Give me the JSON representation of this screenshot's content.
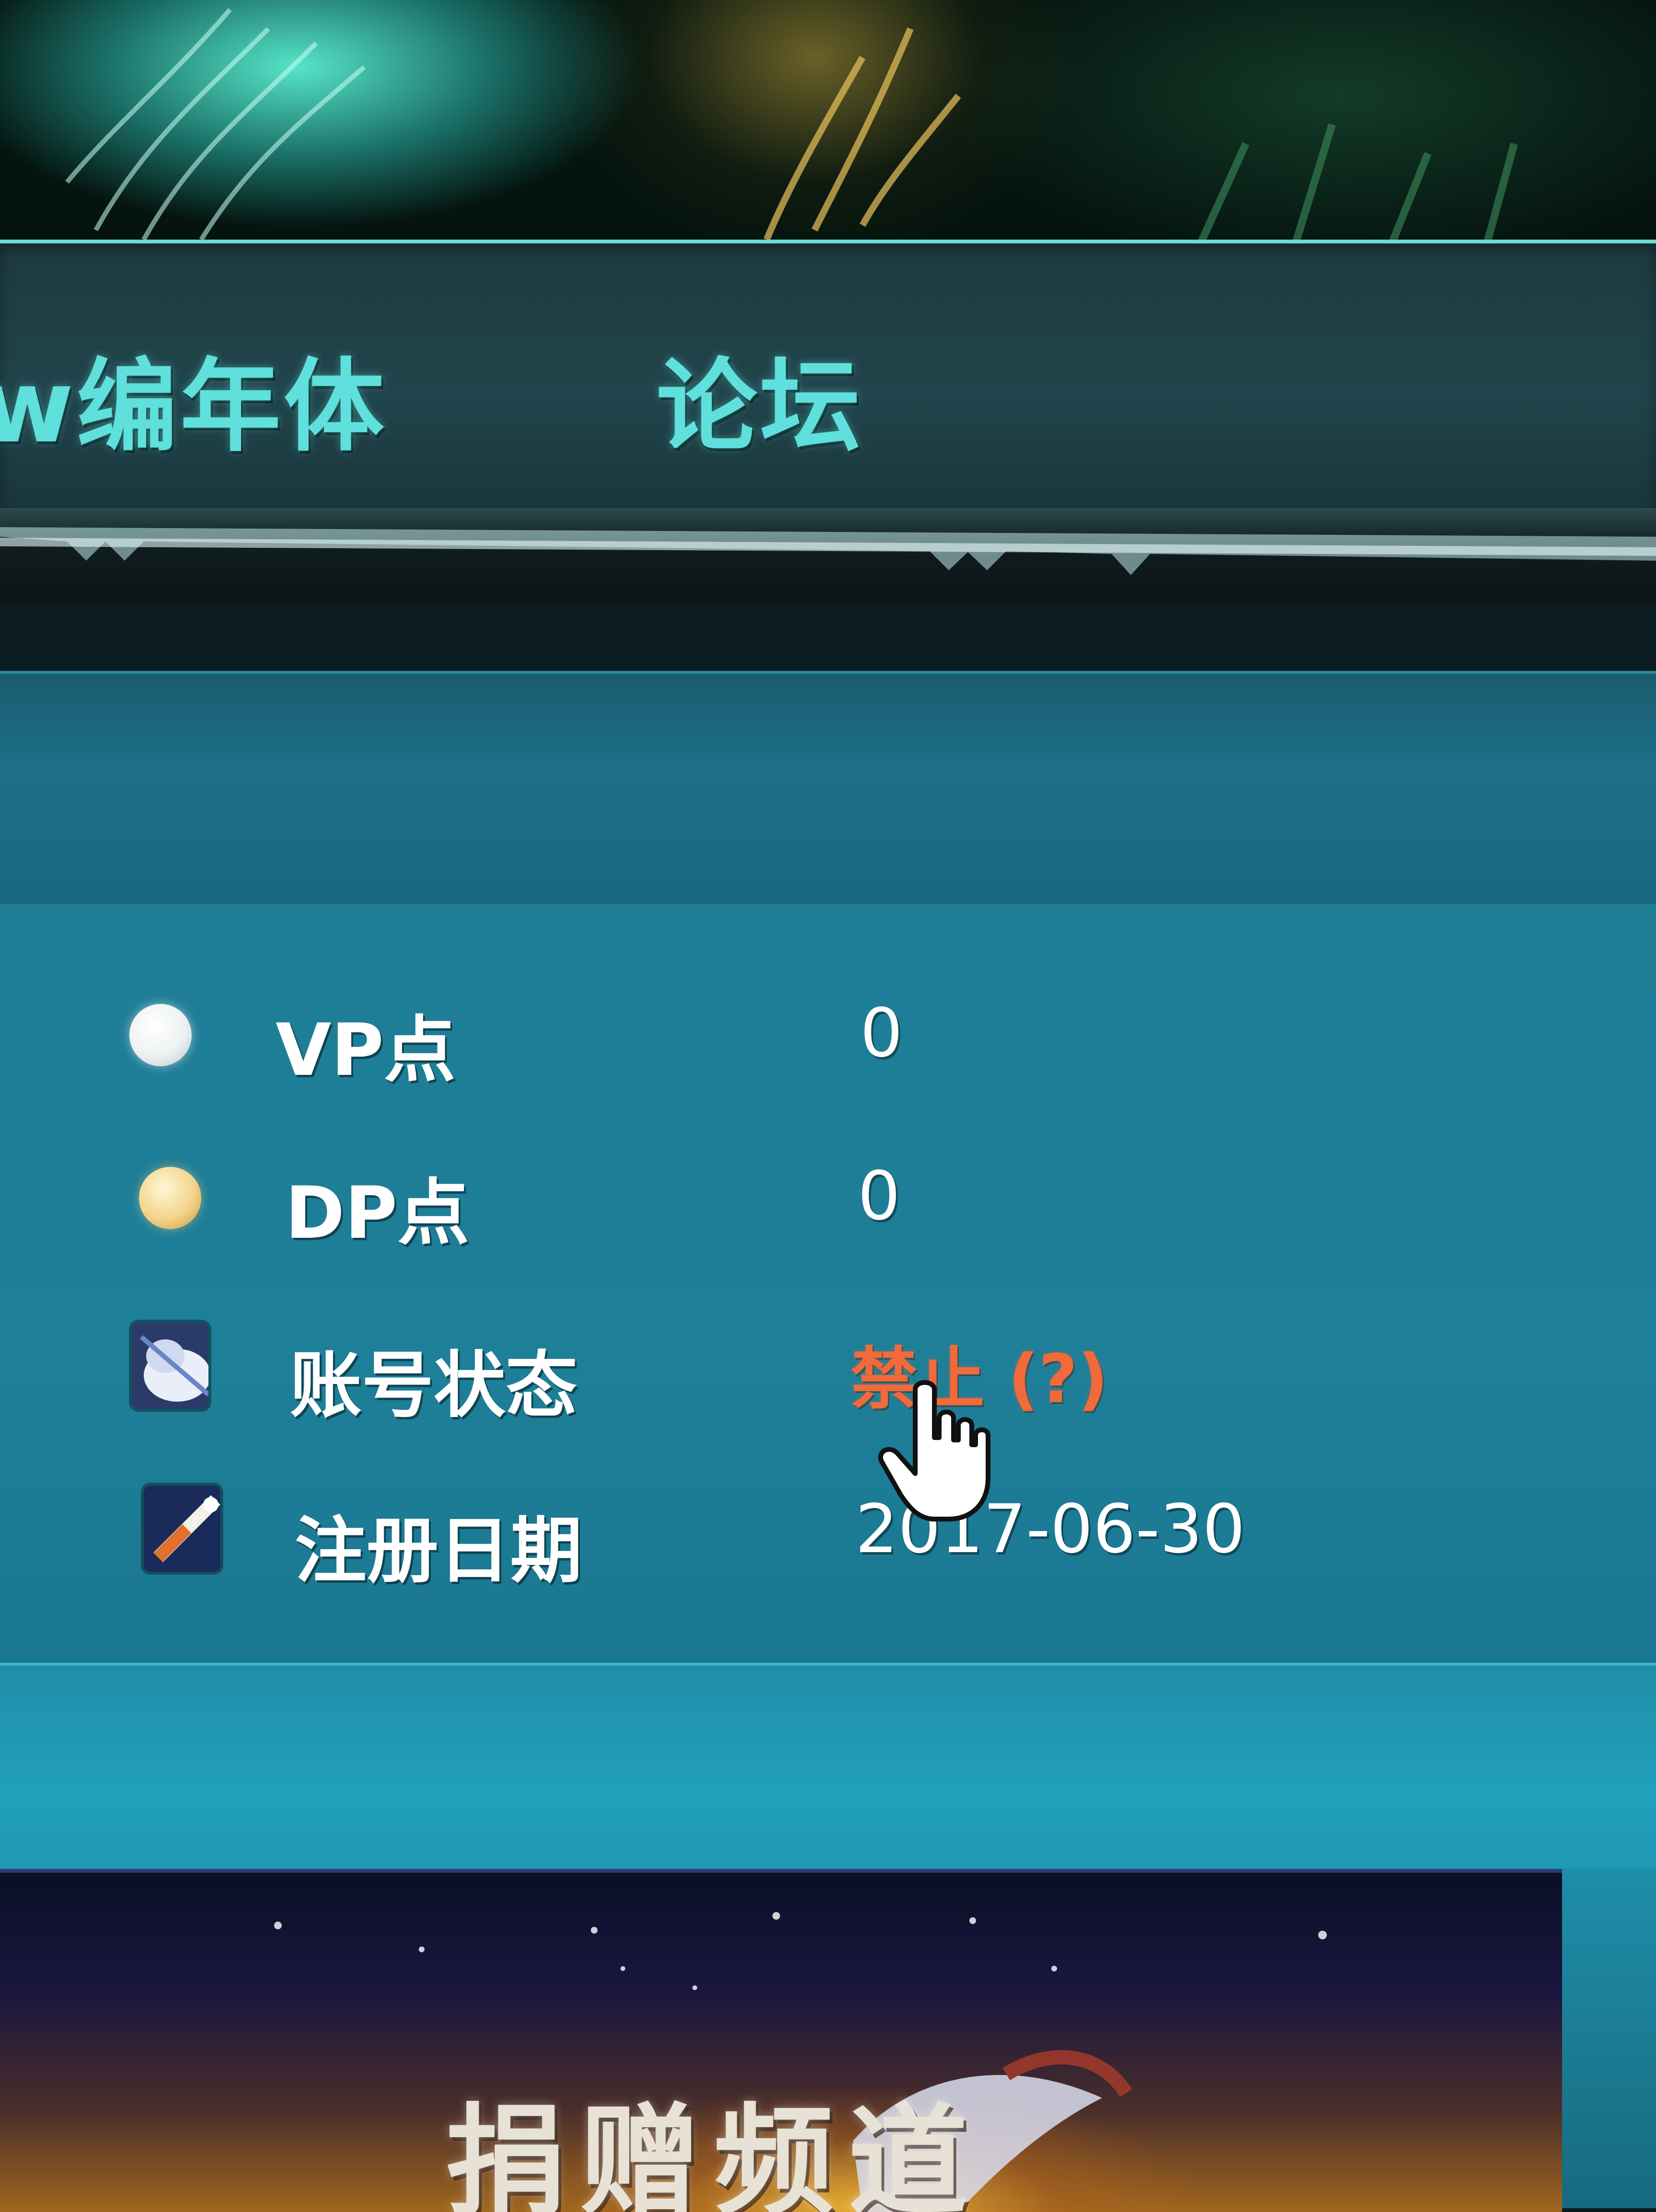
{
  "nav": {
    "items": [
      {
        "label": "w编年体"
      },
      {
        "label": "论坛"
      }
    ]
  },
  "account_info": {
    "rows": [
      {
        "label": "VP点",
        "value": "0",
        "icon": "white-dot-icon"
      },
      {
        "label": "DP点",
        "value": "0",
        "icon": "gold-dot-icon"
      },
      {
        "label": "账号状态",
        "value": "禁止 (?)",
        "icon": "account-status-icon"
      },
      {
        "label": "注册日期",
        "value": "2017-06-30",
        "icon": "register-date-icon"
      }
    ]
  },
  "donate": {
    "label": "捐赠频道"
  },
  "colors": {
    "nav_text": "#5fe0dc",
    "panel_bg": "#1e7f99",
    "status_banned": "#f26a3a",
    "text": "#ffffff"
  }
}
